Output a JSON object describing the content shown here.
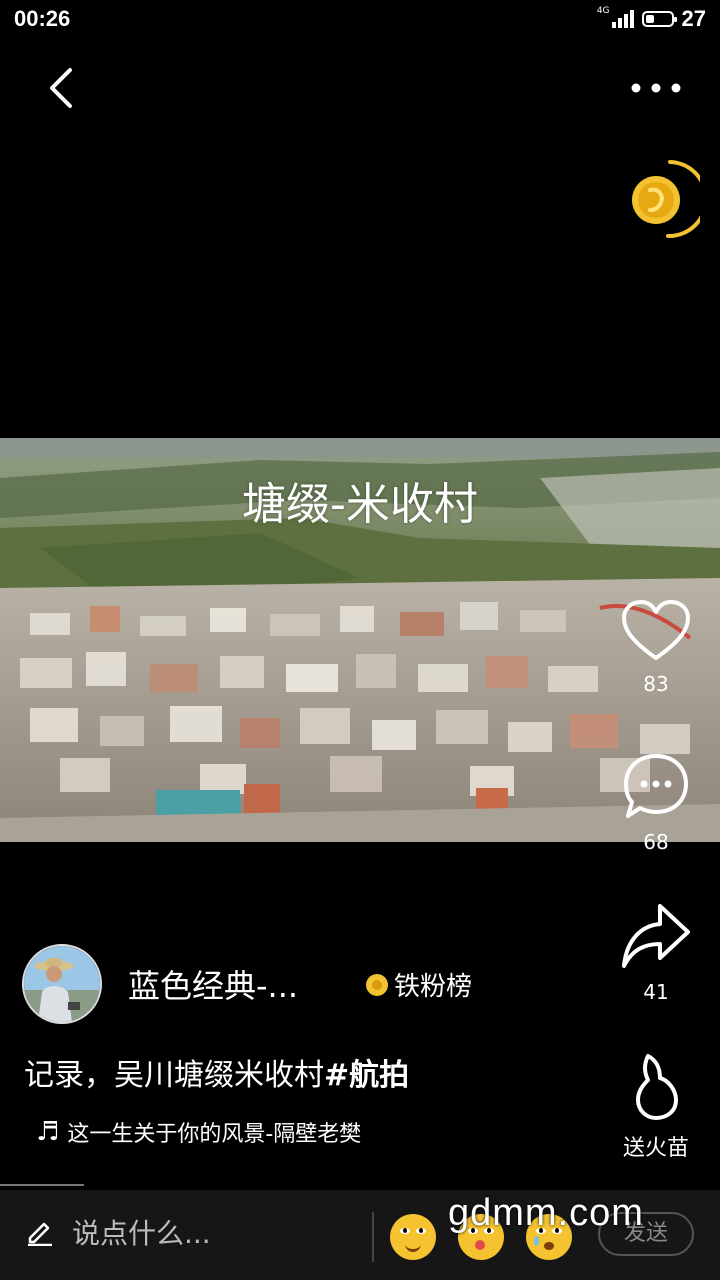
{
  "status_bar": {
    "time": "00:26",
    "network_label": "4G",
    "battery_level": "27"
  },
  "video": {
    "title": "塘缀-米收村"
  },
  "actions": {
    "like_count": "83",
    "comment_count": "68",
    "share_count": "41",
    "gift_label": "送火苗"
  },
  "author": {
    "name": "蓝色经典-...",
    "fans_rank_label": "铁粉榜"
  },
  "caption": {
    "text": "记录，吴川塘缀米收村",
    "hashtag": "#航拍"
  },
  "music": {
    "title": "这一生关于你的风景-隔壁老樊"
  },
  "comment_bar": {
    "placeholder": "说点什么...",
    "send_label": "发送"
  },
  "watermark": "gdmm.com",
  "colors": {
    "background": "#000000",
    "coin": "#f2c230",
    "bottom_bar": "#161616"
  }
}
